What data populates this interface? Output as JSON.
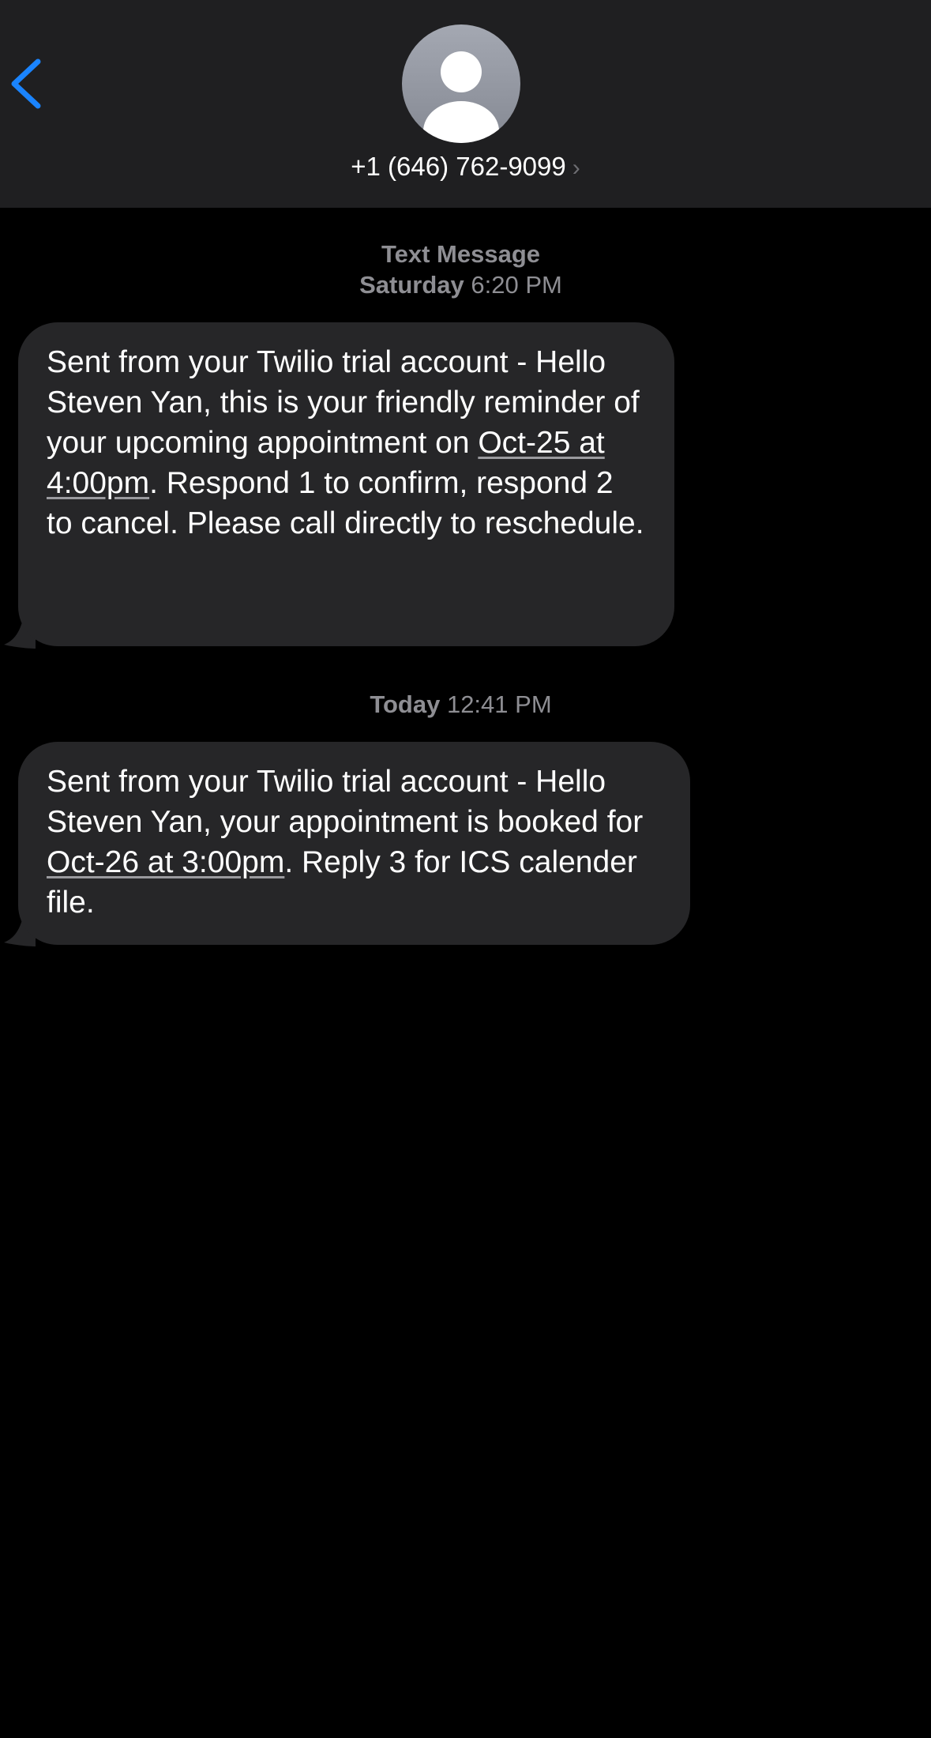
{
  "header": {
    "contact_number": "+1 (646) 762-9099",
    "chevron": "›"
  },
  "thread": {
    "first_ts_label": "Text Message",
    "first_ts_day": "Saturday",
    "first_ts_time": "6:20 PM",
    "second_ts_day": "Today",
    "second_ts_time": "12:41 PM"
  },
  "messages": [
    {
      "lines_before": "Sent from your Twilio trial account - Hello Steven Yan, this is your friendly reminder of your upcoming appointment on ",
      "link": "Oct-25 at 4:00pm",
      "after": ". Respond 1 to confirm, respond 2 to cancel. Please call directly to reschedule."
    },
    {
      "lines_before": "Sent from your Twilio trial account - Hello Steven Yan, your appointment is booked for ",
      "link": "Oct-26 at 3:00pm",
      "after": ". Reply 3 for ICS calender file."
    }
  ],
  "icons": {
    "back": "chevron-left-icon",
    "avatar": "person-silhouette-icon"
  },
  "colors": {
    "accent": "#1a84ff",
    "header_bg": "#1f1f21",
    "bubble_bg": "#262628",
    "timestamp": "#8e8e93"
  }
}
